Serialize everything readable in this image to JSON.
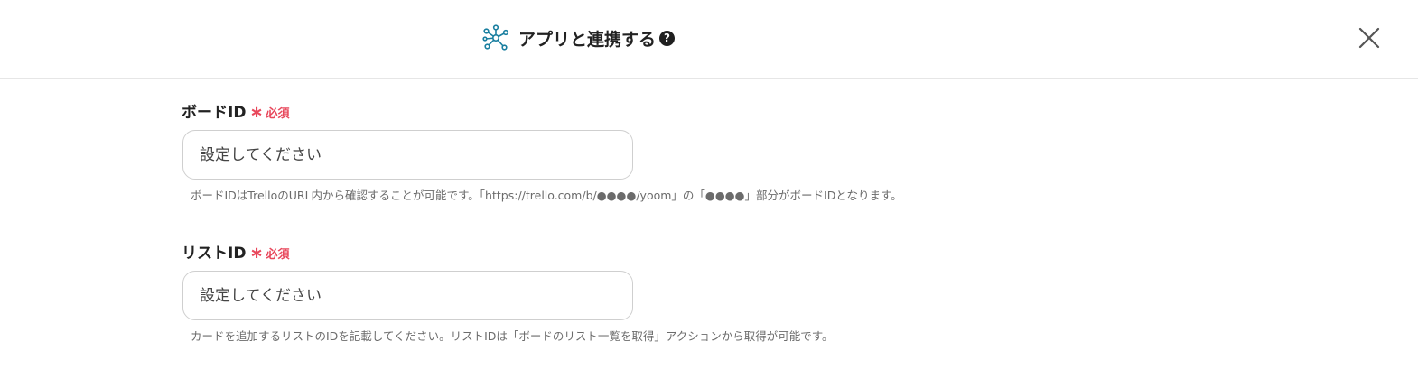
{
  "header": {
    "title": "アプリと連携する",
    "help_glyph": "?",
    "icon_name": "network-nodes-icon",
    "accent_color": "#1a7fa0"
  },
  "fields": [
    {
      "label": "ボードID",
      "required_mark": "∗",
      "required_text": "必須",
      "placeholder": "設定してください",
      "value": "",
      "help": "ボードIDはTrelloのURL内から確認することが可能です。「https://trello.com/b/●●●●/yoom」の「●●●●」部分がボードIDとなります。"
    },
    {
      "label": "リストID",
      "required_mark": "∗",
      "required_text": "必須",
      "placeholder": "設定してください",
      "value": "",
      "help": "カードを追加するリストのIDを記載してください。リストIDは「ボードのリスト一覧を取得」アクションから取得が可能です。"
    }
  ],
  "colors": {
    "required": "#e8475b",
    "border": "#cfcfcf",
    "help_text": "#6b6b6b"
  }
}
